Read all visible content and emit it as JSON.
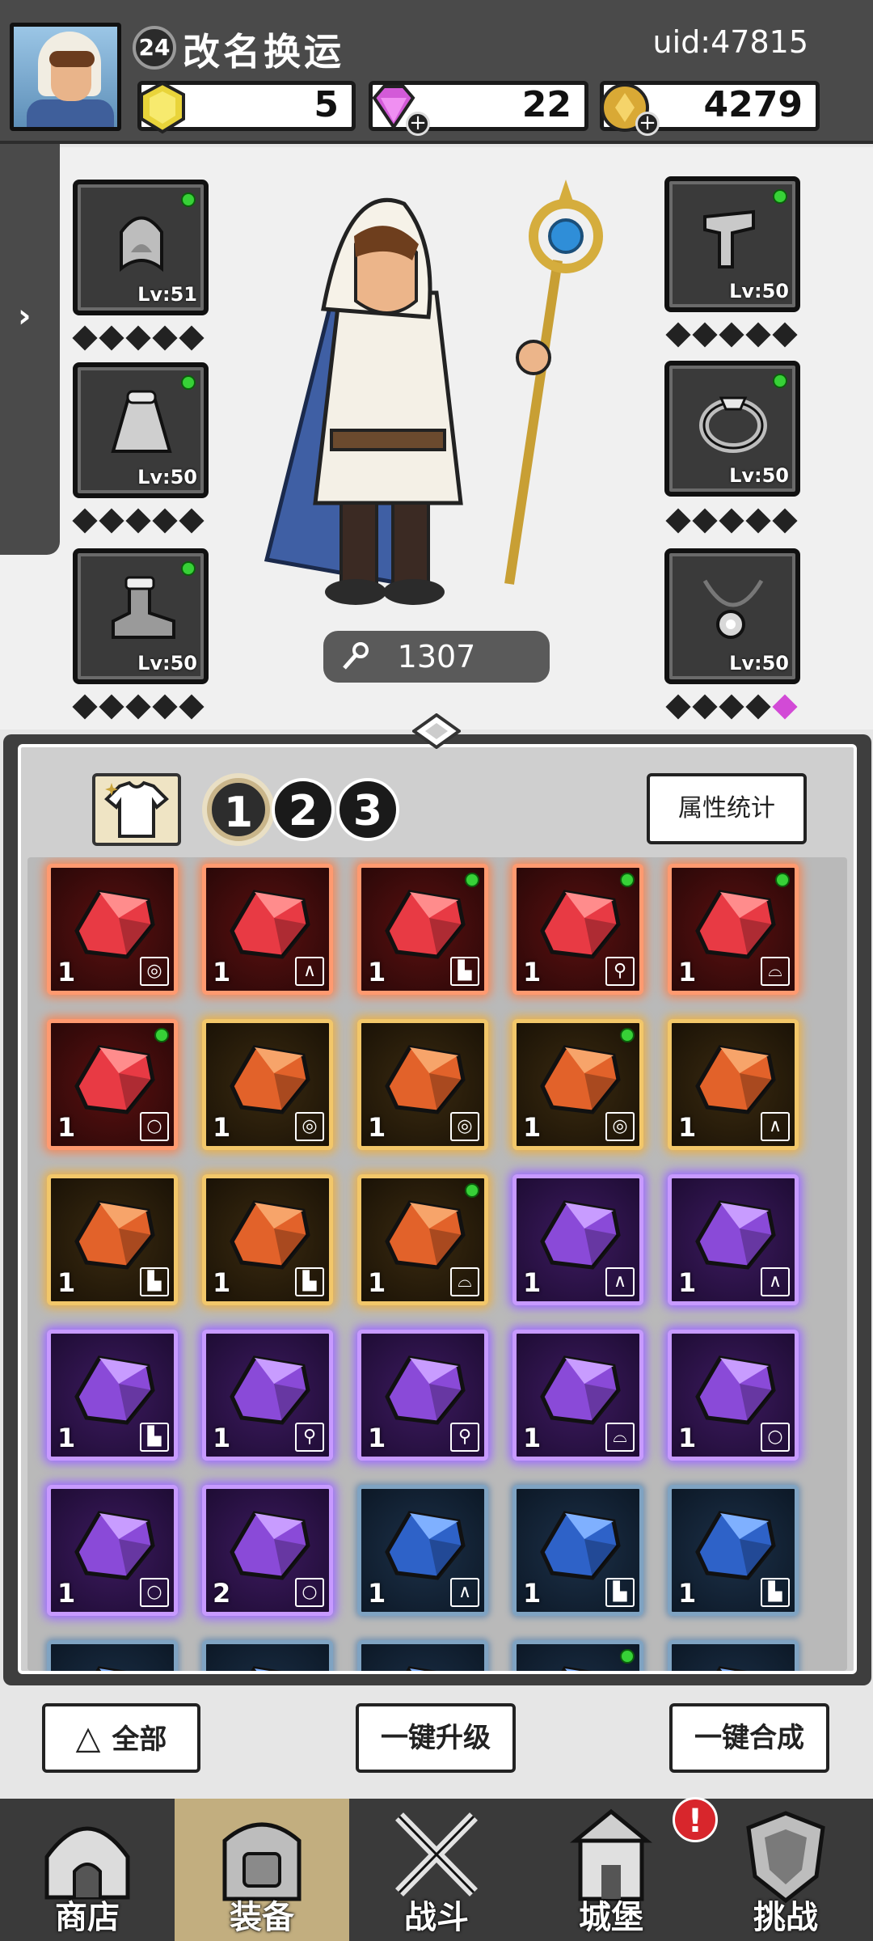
{
  "player": {
    "level": "24",
    "name": "改名换运",
    "uid": "uid:47815"
  },
  "resources": {
    "gold_gem": "5",
    "diamond": "22",
    "coin": "4279"
  },
  "side_tab": {
    "arrow": "›"
  },
  "equipment": {
    "left": [
      {
        "icon": "helmet-icon",
        "level": "Lv:51"
      },
      {
        "icon": "cape-icon",
        "level": "Lv:50"
      },
      {
        "icon": "boot-icon",
        "level": "Lv:50"
      }
    ],
    "right": [
      {
        "icon": "glove-icon",
        "level": "Lv:50"
      },
      {
        "icon": "ring-icon",
        "level": "Lv:50"
      },
      {
        "icon": "necklace-icon",
        "level": "Lv:50"
      }
    ]
  },
  "combat_power": "1307",
  "inventory": {
    "set_tabs": [
      "1",
      "2",
      "3"
    ],
    "active_set": "1",
    "stats_button": "属性统计",
    "gems": [
      {
        "tier": "red",
        "count": "1",
        "slot": "◎",
        "new": false
      },
      {
        "tier": "red",
        "count": "1",
        "slot": "∧",
        "new": false
      },
      {
        "tier": "red",
        "count": "1",
        "slot": "▙",
        "new": true
      },
      {
        "tier": "red",
        "count": "1",
        "slot": "⚲",
        "new": true
      },
      {
        "tier": "red",
        "count": "1",
        "slot": "⌓",
        "new": true
      },
      {
        "tier": "red",
        "count": "1",
        "slot": "○",
        "new": true
      },
      {
        "tier": "orange",
        "count": "1",
        "slot": "◎",
        "new": false
      },
      {
        "tier": "orange",
        "count": "1",
        "slot": "◎",
        "new": false
      },
      {
        "tier": "orange",
        "count": "1",
        "slot": "◎",
        "new": true
      },
      {
        "tier": "orange",
        "count": "1",
        "slot": "∧",
        "new": false
      },
      {
        "tier": "orange",
        "count": "1",
        "slot": "▙",
        "new": false
      },
      {
        "tier": "orange",
        "count": "1",
        "slot": "▙",
        "new": false
      },
      {
        "tier": "orange",
        "count": "1",
        "slot": "⌓",
        "new": true
      },
      {
        "tier": "purple",
        "count": "1",
        "slot": "∧",
        "new": false
      },
      {
        "tier": "purple",
        "count": "1",
        "slot": "∧",
        "new": false
      },
      {
        "tier": "purple",
        "count": "1",
        "slot": "▙",
        "new": false
      },
      {
        "tier": "purple",
        "count": "1",
        "slot": "⚲",
        "new": false
      },
      {
        "tier": "purple",
        "count": "1",
        "slot": "⚲",
        "new": false
      },
      {
        "tier": "purple",
        "count": "1",
        "slot": "⌓",
        "new": false
      },
      {
        "tier": "purple",
        "count": "1",
        "slot": "○",
        "new": false
      },
      {
        "tier": "purple",
        "count": "1",
        "slot": "○",
        "new": false
      },
      {
        "tier": "purple",
        "count": "2",
        "slot": "○",
        "new": false
      },
      {
        "tier": "blue",
        "count": "1",
        "slot": "∧",
        "new": false
      },
      {
        "tier": "blue",
        "count": "1",
        "slot": "▙",
        "new": false
      },
      {
        "tier": "blue",
        "count": "1",
        "slot": "▙",
        "new": false
      },
      {
        "tier": "blue",
        "count": "",
        "slot": "",
        "new": false
      },
      {
        "tier": "blue",
        "count": "",
        "slot": "",
        "new": false
      },
      {
        "tier": "blue",
        "count": "",
        "slot": "",
        "new": false
      },
      {
        "tier": "blue",
        "count": "",
        "slot": "",
        "new": true
      },
      {
        "tier": "blue",
        "count": "",
        "slot": "",
        "new": false
      }
    ]
  },
  "actions": {
    "filter_all": "全部",
    "upgrade_all": "一键升级",
    "merge_all": "一键合成"
  },
  "nav": [
    {
      "label": "商店",
      "icon": "shop-icon"
    },
    {
      "label": "装备",
      "icon": "equipment-bag-icon"
    },
    {
      "label": "战斗",
      "icon": "crossed-swords-icon"
    },
    {
      "label": "城堡",
      "icon": "castle-icon"
    },
    {
      "label": "挑战",
      "icon": "challenge-shield-icon"
    }
  ],
  "nav_active": "装备",
  "castle_alert": "!",
  "colors": {
    "red_tier": "#f08a5c",
    "orange_tier": "#e8b04c",
    "purple_tier": "#9c6bff",
    "blue_tier": "#6f8fb0",
    "new_dot": "#37d137"
  }
}
